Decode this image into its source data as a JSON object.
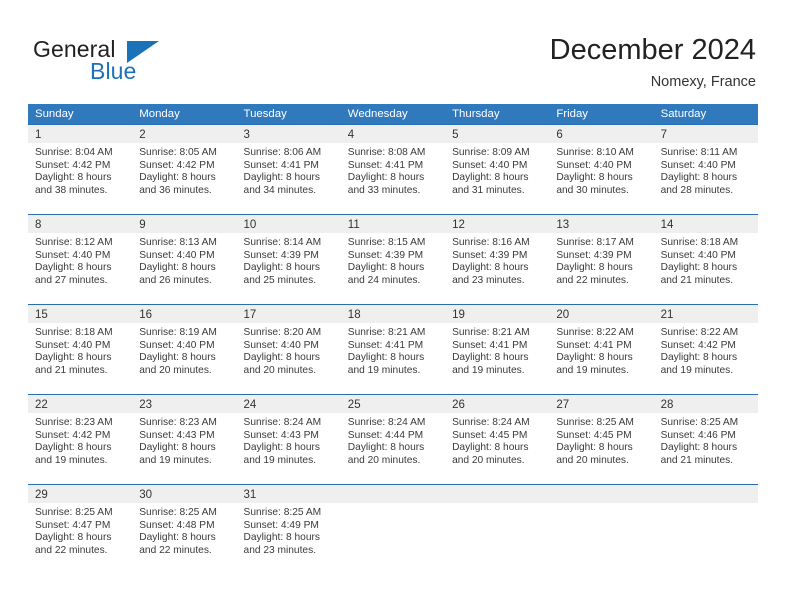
{
  "brand": {
    "name_top": "General",
    "name_bottom": "Blue",
    "accent_color": "#1b72b8",
    "text_color": "#231f20"
  },
  "header": {
    "title": "December 2024",
    "subtitle": "Nomexy, France"
  },
  "theme": {
    "header_row_bg": "#3079bd",
    "week_border": "#2a6db0",
    "day_band_bg": "#efefef",
    "page_bg": "#ffffff",
    "body_text": "#3a3a3a"
  },
  "weekdays": [
    "Sunday",
    "Monday",
    "Tuesday",
    "Wednesday",
    "Thursday",
    "Friday",
    "Saturday"
  ],
  "weeks": [
    [
      {
        "day": "1",
        "sunrise": "Sunrise: 8:04 AM",
        "sunset": "Sunset: 4:42 PM",
        "daylight1": "Daylight: 8 hours",
        "daylight2": "and 38 minutes."
      },
      {
        "day": "2",
        "sunrise": "Sunrise: 8:05 AM",
        "sunset": "Sunset: 4:42 PM",
        "daylight1": "Daylight: 8 hours",
        "daylight2": "and 36 minutes."
      },
      {
        "day": "3",
        "sunrise": "Sunrise: 8:06 AM",
        "sunset": "Sunset: 4:41 PM",
        "daylight1": "Daylight: 8 hours",
        "daylight2": "and 34 minutes."
      },
      {
        "day": "4",
        "sunrise": "Sunrise: 8:08 AM",
        "sunset": "Sunset: 4:41 PM",
        "daylight1": "Daylight: 8 hours",
        "daylight2": "and 33 minutes."
      },
      {
        "day": "5",
        "sunrise": "Sunrise: 8:09 AM",
        "sunset": "Sunset: 4:40 PM",
        "daylight1": "Daylight: 8 hours",
        "daylight2": "and 31 minutes."
      },
      {
        "day": "6",
        "sunrise": "Sunrise: 8:10 AM",
        "sunset": "Sunset: 4:40 PM",
        "daylight1": "Daylight: 8 hours",
        "daylight2": "and 30 minutes."
      },
      {
        "day": "7",
        "sunrise": "Sunrise: 8:11 AM",
        "sunset": "Sunset: 4:40 PM",
        "daylight1": "Daylight: 8 hours",
        "daylight2": "and 28 minutes."
      }
    ],
    [
      {
        "day": "8",
        "sunrise": "Sunrise: 8:12 AM",
        "sunset": "Sunset: 4:40 PM",
        "daylight1": "Daylight: 8 hours",
        "daylight2": "and 27 minutes."
      },
      {
        "day": "9",
        "sunrise": "Sunrise: 8:13 AM",
        "sunset": "Sunset: 4:40 PM",
        "daylight1": "Daylight: 8 hours",
        "daylight2": "and 26 minutes."
      },
      {
        "day": "10",
        "sunrise": "Sunrise: 8:14 AM",
        "sunset": "Sunset: 4:39 PM",
        "daylight1": "Daylight: 8 hours",
        "daylight2": "and 25 minutes."
      },
      {
        "day": "11",
        "sunrise": "Sunrise: 8:15 AM",
        "sunset": "Sunset: 4:39 PM",
        "daylight1": "Daylight: 8 hours",
        "daylight2": "and 24 minutes."
      },
      {
        "day": "12",
        "sunrise": "Sunrise: 8:16 AM",
        "sunset": "Sunset: 4:39 PM",
        "daylight1": "Daylight: 8 hours",
        "daylight2": "and 23 minutes."
      },
      {
        "day": "13",
        "sunrise": "Sunrise: 8:17 AM",
        "sunset": "Sunset: 4:39 PM",
        "daylight1": "Daylight: 8 hours",
        "daylight2": "and 22 minutes."
      },
      {
        "day": "14",
        "sunrise": "Sunrise: 8:18 AM",
        "sunset": "Sunset: 4:40 PM",
        "daylight1": "Daylight: 8 hours",
        "daylight2": "and 21 minutes."
      }
    ],
    [
      {
        "day": "15",
        "sunrise": "Sunrise: 8:18 AM",
        "sunset": "Sunset: 4:40 PM",
        "daylight1": "Daylight: 8 hours",
        "daylight2": "and 21 minutes."
      },
      {
        "day": "16",
        "sunrise": "Sunrise: 8:19 AM",
        "sunset": "Sunset: 4:40 PM",
        "daylight1": "Daylight: 8 hours",
        "daylight2": "and 20 minutes."
      },
      {
        "day": "17",
        "sunrise": "Sunrise: 8:20 AM",
        "sunset": "Sunset: 4:40 PM",
        "daylight1": "Daylight: 8 hours",
        "daylight2": "and 20 minutes."
      },
      {
        "day": "18",
        "sunrise": "Sunrise: 8:21 AM",
        "sunset": "Sunset: 4:41 PM",
        "daylight1": "Daylight: 8 hours",
        "daylight2": "and 19 minutes."
      },
      {
        "day": "19",
        "sunrise": "Sunrise: 8:21 AM",
        "sunset": "Sunset: 4:41 PM",
        "daylight1": "Daylight: 8 hours",
        "daylight2": "and 19 minutes."
      },
      {
        "day": "20",
        "sunrise": "Sunrise: 8:22 AM",
        "sunset": "Sunset: 4:41 PM",
        "daylight1": "Daylight: 8 hours",
        "daylight2": "and 19 minutes."
      },
      {
        "day": "21",
        "sunrise": "Sunrise: 8:22 AM",
        "sunset": "Sunset: 4:42 PM",
        "daylight1": "Daylight: 8 hours",
        "daylight2": "and 19 minutes."
      }
    ],
    [
      {
        "day": "22",
        "sunrise": "Sunrise: 8:23 AM",
        "sunset": "Sunset: 4:42 PM",
        "daylight1": "Daylight: 8 hours",
        "daylight2": "and 19 minutes."
      },
      {
        "day": "23",
        "sunrise": "Sunrise: 8:23 AM",
        "sunset": "Sunset: 4:43 PM",
        "daylight1": "Daylight: 8 hours",
        "daylight2": "and 19 minutes."
      },
      {
        "day": "24",
        "sunrise": "Sunrise: 8:24 AM",
        "sunset": "Sunset: 4:43 PM",
        "daylight1": "Daylight: 8 hours",
        "daylight2": "and 19 minutes."
      },
      {
        "day": "25",
        "sunrise": "Sunrise: 8:24 AM",
        "sunset": "Sunset: 4:44 PM",
        "daylight1": "Daylight: 8 hours",
        "daylight2": "and 20 minutes."
      },
      {
        "day": "26",
        "sunrise": "Sunrise: 8:24 AM",
        "sunset": "Sunset: 4:45 PM",
        "daylight1": "Daylight: 8 hours",
        "daylight2": "and 20 minutes."
      },
      {
        "day": "27",
        "sunrise": "Sunrise: 8:25 AM",
        "sunset": "Sunset: 4:45 PM",
        "daylight1": "Daylight: 8 hours",
        "daylight2": "and 20 minutes."
      },
      {
        "day": "28",
        "sunrise": "Sunrise: 8:25 AM",
        "sunset": "Sunset: 4:46 PM",
        "daylight1": "Daylight: 8 hours",
        "daylight2": "and 21 minutes."
      }
    ],
    [
      {
        "day": "29",
        "sunrise": "Sunrise: 8:25 AM",
        "sunset": "Sunset: 4:47 PM",
        "daylight1": "Daylight: 8 hours",
        "daylight2": "and 22 minutes."
      },
      {
        "day": "30",
        "sunrise": "Sunrise: 8:25 AM",
        "sunset": "Sunset: 4:48 PM",
        "daylight1": "Daylight: 8 hours",
        "daylight2": "and 22 minutes."
      },
      {
        "day": "31",
        "sunrise": "Sunrise: 8:25 AM",
        "sunset": "Sunset: 4:49 PM",
        "daylight1": "Daylight: 8 hours",
        "daylight2": "and 23 minutes."
      },
      {
        "day": "",
        "sunrise": "",
        "sunset": "",
        "daylight1": "",
        "daylight2": ""
      },
      {
        "day": "",
        "sunrise": "",
        "sunset": "",
        "daylight1": "",
        "daylight2": ""
      },
      {
        "day": "",
        "sunrise": "",
        "sunset": "",
        "daylight1": "",
        "daylight2": ""
      },
      {
        "day": "",
        "sunrise": "",
        "sunset": "",
        "daylight1": "",
        "daylight2": ""
      }
    ]
  ]
}
